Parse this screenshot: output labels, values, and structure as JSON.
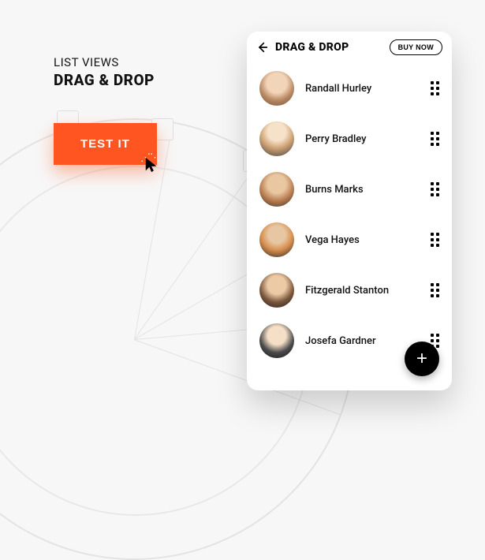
{
  "heading": {
    "subtitle": "LIST VIEWS",
    "title": "DRAG & DROP"
  },
  "cta": {
    "label": "TEST IT"
  },
  "app": {
    "title": "DRAG & DROP",
    "buy_label": "BUY NOW",
    "fab_icon": "+",
    "items": [
      {
        "name": "Randall Hurley"
      },
      {
        "name": "Perry Bradley"
      },
      {
        "name": "Burns Marks"
      },
      {
        "name": "Vega Hayes"
      },
      {
        "name": "Fitzgerald Stanton"
      },
      {
        "name": "Josefa Gardner"
      }
    ]
  },
  "colors": {
    "accent": "#ff5521"
  }
}
